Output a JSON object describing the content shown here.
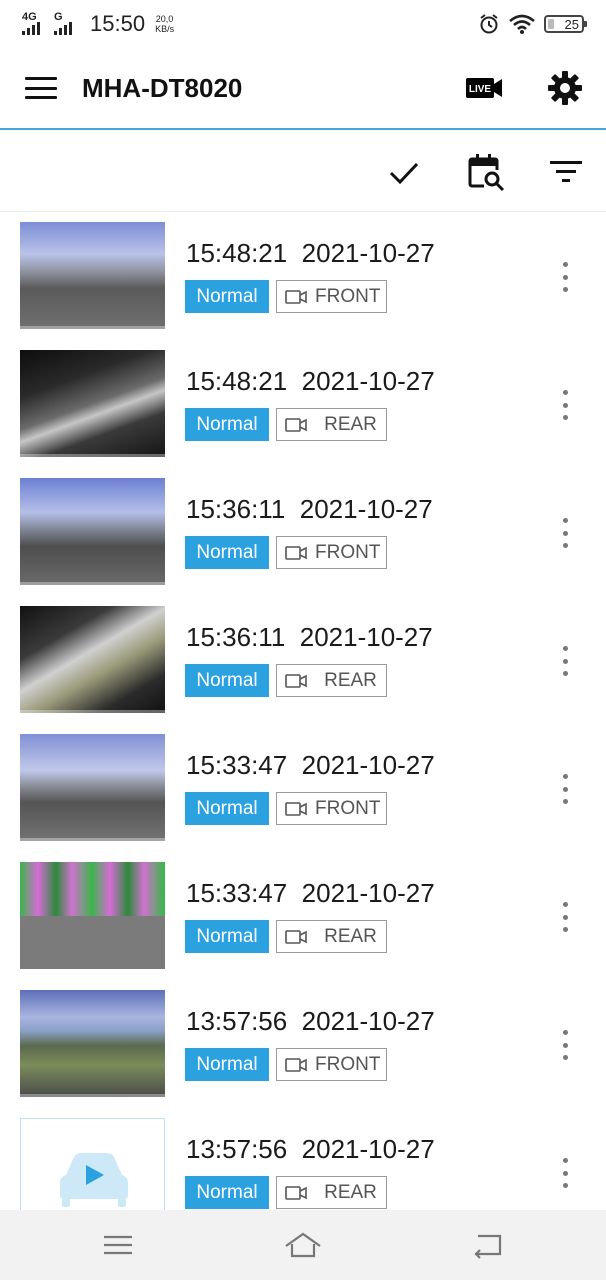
{
  "status_bar": {
    "network1": "4G",
    "network2": "G",
    "time": "15:50",
    "rate_value": "20,0",
    "rate_unit": "KB/s",
    "battery": "25"
  },
  "app_bar": {
    "title": "MHA-DT8020",
    "live_label": "LIVE"
  },
  "recordings": [
    {
      "time": "15:48:21",
      "date": "2021-10-27",
      "status": "Normal",
      "camera": "FRONT"
    },
    {
      "time": "15:48:21",
      "date": "2021-10-27",
      "status": "Normal",
      "camera": "REAR"
    },
    {
      "time": "15:36:11",
      "date": "2021-10-27",
      "status": "Normal",
      "camera": "FRONT"
    },
    {
      "time": "15:36:11",
      "date": "2021-10-27",
      "status": "Normal",
      "camera": "REAR"
    },
    {
      "time": "15:33:47",
      "date": "2021-10-27",
      "status": "Normal",
      "camera": "FRONT"
    },
    {
      "time": "15:33:47",
      "date": "2021-10-27",
      "status": "Normal",
      "camera": "REAR"
    },
    {
      "time": "13:57:56",
      "date": "2021-10-27",
      "status": "Normal",
      "camera": "FRONT"
    },
    {
      "time": "13:57:56",
      "date": "2021-10-27",
      "status": "Normal",
      "camera": "REAR"
    }
  ],
  "colors": {
    "accent": "#2ba1e0",
    "divider": "#45a8d9"
  }
}
